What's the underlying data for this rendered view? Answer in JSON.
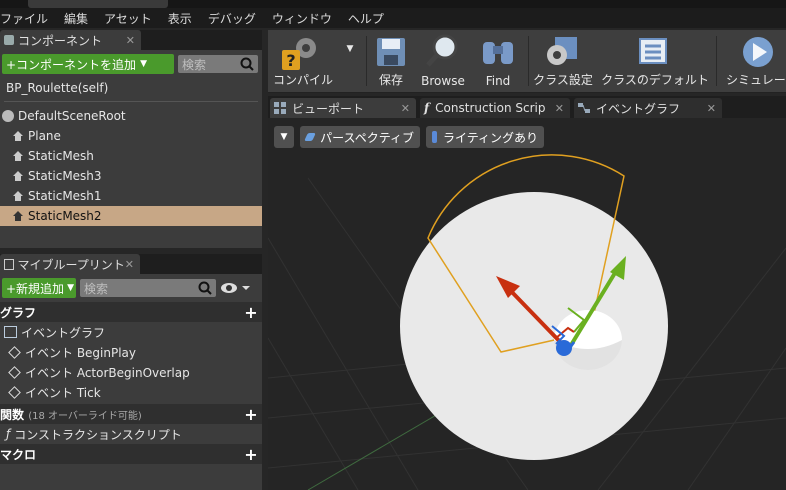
{
  "menubar": [
    "ファイル",
    "編集",
    "アセット",
    "表示",
    "デバッグ",
    "ウィンドウ",
    "ヘルプ"
  ],
  "components": {
    "tab_label": "コンポーネント",
    "add_button": "+コンポーネントを追加",
    "search_placeholder": "検索",
    "self_item": "BP_Roulette(self)",
    "root": "DefaultSceneRoot",
    "items": [
      "Plane",
      "StaticMesh",
      "StaticMesh3",
      "StaticMesh1",
      "StaticMesh2"
    ],
    "selected": "StaticMesh2"
  },
  "blueprint": {
    "tab_label": "マイブループリント",
    "add_button": "+新規追加",
    "search_placeholder": "検索",
    "sections": {
      "graph": "グラフ",
      "event_graph": "イベントグラフ",
      "events": [
        "イベント BeginPlay",
        "イベント ActorBeginOverlap",
        "イベント Tick"
      ],
      "functions": "関数",
      "functions_note": "(18 オーバーライド可能)",
      "construction": "コンストラクションスクリプト",
      "macros": "マクロ"
    }
  },
  "toolbar": {
    "compile": "コンパイル",
    "save": "保存",
    "browse": "Browse",
    "find": "Find",
    "class_settings": "クラス設定",
    "class_defaults": "クラスのデフォルト",
    "simulation": "シミュレーシ"
  },
  "viewport_tabs": [
    "ビューポート",
    "Construction Scrip",
    "イベントグラフ"
  ],
  "viewport": {
    "perspective": "パースペクティブ",
    "lighting": "ライティングあり"
  },
  "colors": {
    "accent_green": "#4a9a2c",
    "selection": "#c7a786",
    "wedge_outline": "#e0a020",
    "gizmo_x": "#c83010",
    "gizmo_y": "#6ab020",
    "gizmo_z": "#2a6ad8"
  }
}
